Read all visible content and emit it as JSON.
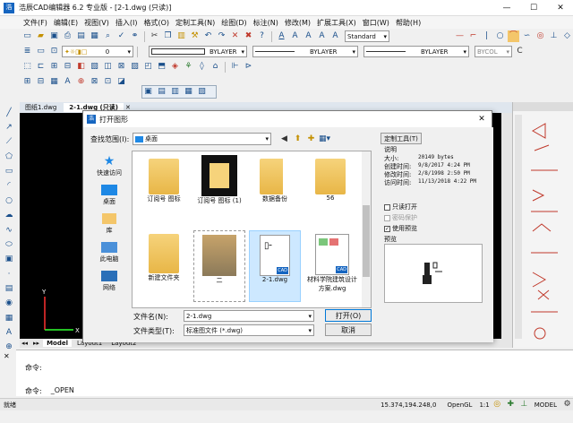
{
  "app": {
    "title": "浩辰CAD编辑器 6.2 专业版 - [2-1.dwg (只读)]",
    "window_controls": {
      "min": "—",
      "max": "☐",
      "close": "✕"
    }
  },
  "menu": [
    "文件(F)",
    "编辑(E)",
    "视图(V)",
    "插入(I)",
    "格式(O)",
    "定制工具(N)",
    "绘图(D)",
    "标注(N)",
    "修改(M)",
    "扩展工具(X)",
    "窗口(W)",
    "帮助(H)"
  ],
  "toolbar": {
    "text_style": "Standard",
    "layer": "0",
    "color": "BYLAYER",
    "linetype": "BYLAYER",
    "lineweight": "BYLAYER",
    "plot": "BYCOL"
  },
  "doc_tabs": [
    "图纸1.dwg",
    "2-1.dwg (只读)"
  ],
  "layout_tabs": [
    "Model",
    "Layout1",
    "Layout2"
  ],
  "command": {
    "history": "命令:",
    "prompt_label": "命令:",
    "prompt_value": "_OPEN"
  },
  "status": {
    "left": "就绪",
    "coords": "15.374,194.248,0",
    "opengl": "OpenGL",
    "scale": "1:1",
    "model": "MODEL"
  },
  "dialog": {
    "title": "打开图形",
    "close": "✕",
    "look_in_label": "查找范围(I):",
    "look_in_value": "桌面",
    "places": [
      {
        "label": "快速访问",
        "icon": "star-icon"
      },
      {
        "label": "桌面",
        "icon": "desktop-icon"
      },
      {
        "label": "库",
        "icon": "library-icon"
      },
      {
        "label": "此电脑",
        "icon": "computer-icon"
      },
      {
        "label": "网络",
        "icon": "network-icon"
      }
    ],
    "files": [
      {
        "name": "订阅号 图标",
        "kind": "folder"
      },
      {
        "name": "订阅号 图标 (1)",
        "kind": "folder-dark"
      },
      {
        "name": "数据备份",
        "kind": "folder"
      },
      {
        "name": "56",
        "kind": "folder"
      },
      {
        "name": "新建文件夹",
        "kind": "folder"
      },
      {
        "name": "二",
        "kind": "folder-photo"
      },
      {
        "name": "2-1.dwg",
        "kind": "dwg"
      },
      {
        "name": "材料学院建筑设计方案.dwg",
        "kind": "dwg"
      }
    ],
    "filename_label": "文件名(N):",
    "filename_value": "2-1.dwg",
    "filetype_label": "文件类型(T):",
    "filetype_value": "标准图文件 (*.dwg)",
    "open_button": "打开(O)",
    "cancel_button": "取消",
    "tools_button": "定制工具(T)",
    "info_header": "说明",
    "info": [
      {
        "k": "大小:",
        "v": "20149 bytes"
      },
      {
        "k": "创建时间:",
        "v": "9/8/2017 4:24 PM"
      },
      {
        "k": "修改时间:",
        "v": "2/8/1998 2:50 PM"
      },
      {
        "k": "访问时间:",
        "v": "11/13/2018 4:22 PM"
      }
    ],
    "readonly_label": "只读打开",
    "password_label": "密码保护",
    "preview_check_label": "使用预览",
    "preview_label": "预览"
  }
}
